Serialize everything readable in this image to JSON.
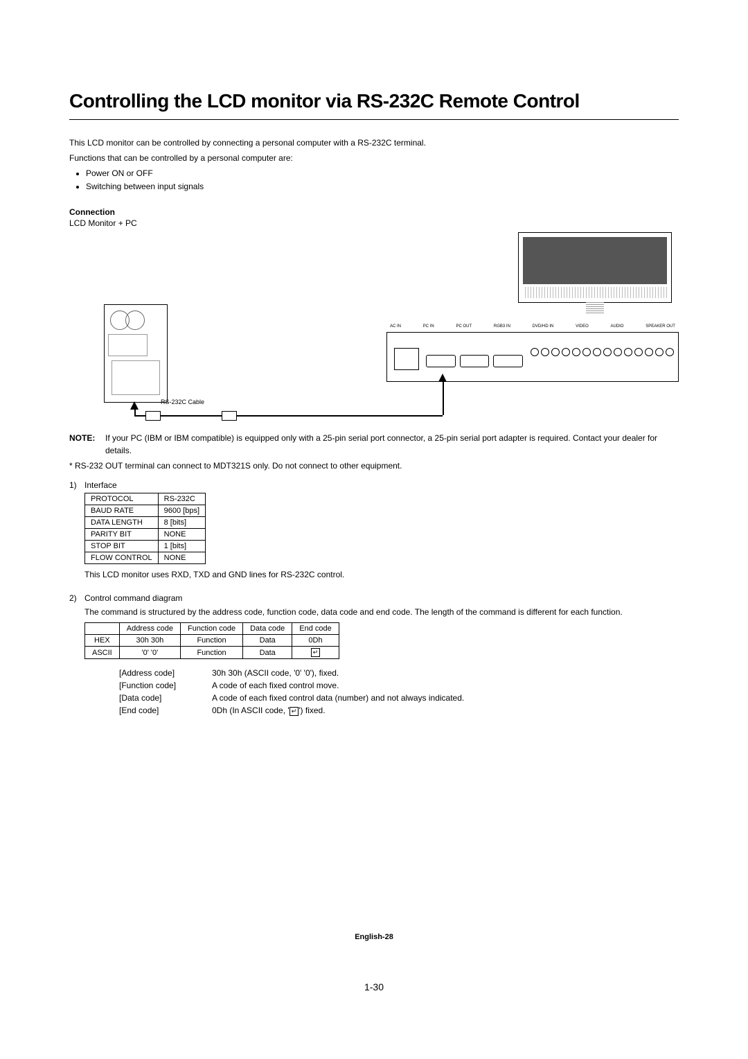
{
  "title": "Controlling the LCD monitor via RS-232C Remote Control",
  "intro1": "This LCD monitor can be controlled by connecting a personal computer with a RS-232C terminal.",
  "intro2": "Functions that can be controlled by a personal computer are:",
  "bullets": [
    "Power ON or OFF",
    "Switching between input signals"
  ],
  "connection_heading": "Connection",
  "connection_sub": "LCD Monitor + PC",
  "cable_label": "RS-232C Cable",
  "io_labels": [
    "AC IN",
    "PC IN",
    "PC OUT",
    "RGB3 IN",
    "DVD/HD IN",
    "VIDEO",
    "AUDIO",
    "SPEAKER OUT"
  ],
  "note_label": "NOTE:",
  "note_text": "If your PC (IBM or IBM compatible) is equipped only with a 25-pin serial port connector, a 25-pin serial port adapter is required. Contact your dealer for details.",
  "asterisk": "* RS-232 OUT terminal can connect to MDT321S only. Do not connect to other equipment.",
  "sec1_num": "1)",
  "sec1_title": "Interface",
  "iface": [
    [
      "PROTOCOL",
      "RS-232C"
    ],
    [
      "BAUD RATE",
      "9600 [bps]"
    ],
    [
      "DATA LENGTH",
      "8 [bits]"
    ],
    [
      "PARITY BIT",
      "NONE"
    ],
    [
      "STOP BIT",
      "1 [bits]"
    ],
    [
      "FLOW CONTROL",
      "NONE"
    ]
  ],
  "iface_note": "This LCD monitor uses RXD, TXD and GND lines for RS-232C control.",
  "sec2_num": "2)",
  "sec2_title": "Control command diagram",
  "sec2_desc": "The command is structured by the address code, function code, data code and end code. The length of the command is different for each function.",
  "cmd_headers": [
    "",
    "Address code",
    "Function code",
    "Data code",
    "End code"
  ],
  "cmd_rows": [
    [
      "HEX",
      "30h 30h",
      "Function",
      "Data",
      "0Dh"
    ],
    [
      "ASCII",
      "'0' '0'",
      "Function",
      "Data",
      "⏎"
    ]
  ],
  "codes": [
    {
      "k": "[Address code]",
      "v": "30h 30h (ASCII code, '0' '0'), fixed."
    },
    {
      "k": "[Function code]",
      "v": "A code of each fixed control move."
    },
    {
      "k": "[Data code]",
      "v": "A code of each fixed control data (number) and not always indicated."
    },
    {
      "k": "[End code]",
      "v": "0Dh (In ASCII code, ' ⏎ ') fixed."
    }
  ],
  "page_lang": "English-28",
  "page_num": "1-30"
}
